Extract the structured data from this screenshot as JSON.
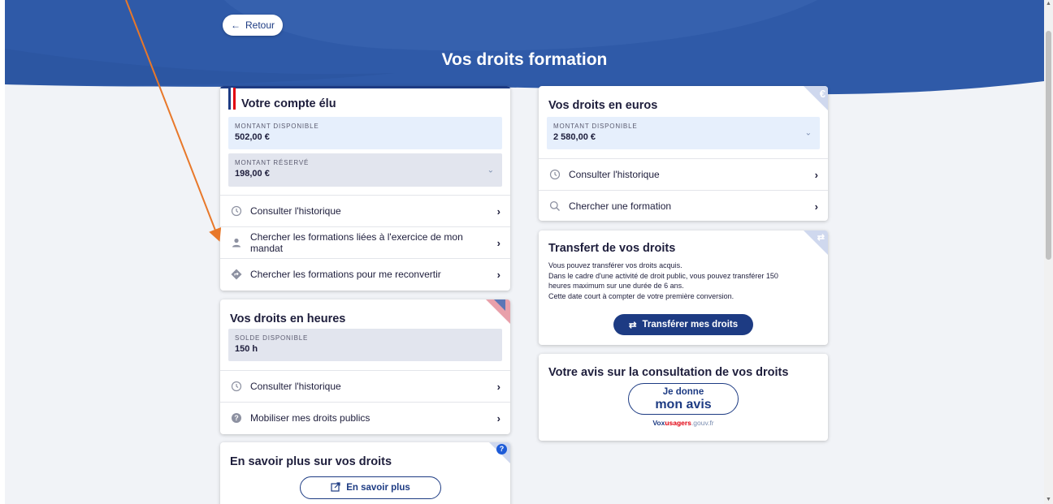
{
  "header": {
    "back_label": "Retour",
    "title": "Vos droits formation",
    "brand_color": "#2f5aa8"
  },
  "card_elu": {
    "title": "Votre compte élu",
    "available_label": "MONTANT DISPONIBLE",
    "available_value": "502,00 €",
    "reserved_label": "MONTANT RÉSERVÉ",
    "reserved_value": "198,00 €",
    "rows": [
      {
        "label": "Consulter l'historique",
        "icon": "history-icon"
      },
      {
        "label": "Chercher les formations liées à l'exercice de mon mandat",
        "icon": "person-icon"
      },
      {
        "label": "Chercher les formations pour me reconvertir",
        "icon": "direction-icon"
      }
    ]
  },
  "card_heures": {
    "title": "Vos droits en heures",
    "balance_label": "SOLDE DISPONIBLE",
    "balance_value": "150 h",
    "rows": [
      {
        "label": "Consulter l'historique",
        "icon": "history-icon"
      },
      {
        "label": "Mobiliser mes droits publics",
        "icon": "question-icon"
      }
    ]
  },
  "card_savoir": {
    "title": "En savoir plus sur vos droits",
    "button_label": "En savoir plus"
  },
  "card_euros": {
    "title": "Vos droits en euros",
    "corner_symbol": "€",
    "available_label": "MONTANT DISPONIBLE",
    "available_value": "2 580,00 €",
    "rows": [
      {
        "label": "Consulter l'historique",
        "icon": "history-icon"
      },
      {
        "label": "Chercher une formation",
        "icon": "search-icon"
      }
    ]
  },
  "card_transfert": {
    "title": "Transfert de vos droits",
    "lines": [
      "Vous pouvez transférer vos droits acquis.",
      "Dans le cadre d'une activité de droit public, vous pouvez transférer 150",
      "heures maximum sur une durée de 6 ans.",
      "Cette date court à compter de votre première conversion."
    ],
    "button_label": "Transférer mes droits"
  },
  "card_avis": {
    "title": "Votre avis sur la consultation de vos droits",
    "badge_line1": "Je donne",
    "badge_line2": "mon avis",
    "voxusagers_vox": "Vox",
    "voxusagers_usagers": "usagers",
    "voxusagers_domain": ".gouv.fr"
  },
  "colors": {
    "navy": "#1d3b83",
    "field_blue": "#e6effc",
    "field_grey": "#e2e5ee",
    "annotation_arrow": "#e8782a"
  }
}
